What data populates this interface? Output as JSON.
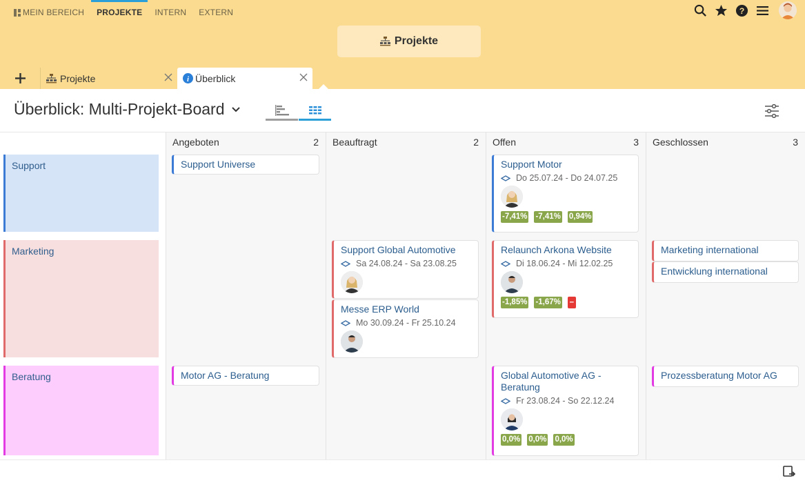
{
  "topnav": {
    "items": [
      {
        "label": "MEIN BEREICH"
      },
      {
        "label": "PROJEKTE"
      },
      {
        "label": "INTERN"
      },
      {
        "label": "EXTERN"
      }
    ],
    "active_index": 1
  },
  "header": {
    "title": "Projekte"
  },
  "tabs": [
    {
      "label": "Projekte",
      "icon": "hierarchy-icon"
    },
    {
      "label": "Überblick",
      "icon": "info-icon"
    }
  ],
  "board": {
    "title": "Überblick: Multi-Projekt-Board",
    "columns": [
      {
        "name": "Angeboten",
        "count": "2"
      },
      {
        "name": "Beauftragt",
        "count": "2"
      },
      {
        "name": "Offen",
        "count": "3"
      },
      {
        "name": "Geschlossen",
        "count": "3"
      }
    ],
    "rows": [
      {
        "name": "Support",
        "color": "#3b7bd6",
        "bg": "#d6e4f7"
      },
      {
        "name": "Marketing",
        "color": "#e06a6a",
        "bg": "#f7dfdf"
      },
      {
        "name": "Beratung",
        "color": "#e33be3",
        "bg": "#fdcdfd"
      }
    ],
    "cards": {
      "support_universe": {
        "title": "Support Universe"
      },
      "support_motor": {
        "title": "Support Motor",
        "dates": "Do 25.07.24 - Do 24.07.25",
        "kpis": [
          "-7,41%",
          "-7,41%",
          "0,94%"
        ]
      },
      "support_global": {
        "title": "Support Global Automotive",
        "dates": "Sa 24.08.24 - Sa 23.08.25"
      },
      "messe_erp": {
        "title": "Messe ERP World",
        "dates": "Mo 30.09.24 - Fr 25.10.24"
      },
      "relaunch": {
        "title": "Relaunch Arkona Website",
        "dates": "Di 18.06.24 - Mi 12.02.25",
        "kpis": [
          "-1,85%",
          "-1,67%"
        ],
        "kpi_flag": "–"
      },
      "marketing_int": {
        "title": "Marketing international"
      },
      "entwicklung_int": {
        "title": "Entwicklung international"
      },
      "motor_ag": {
        "title": "Motor AG - Beratung"
      },
      "global_ag": {
        "title": "Global Automotive AG - Beratung",
        "dates": "Fr 23.08.24 - So 22.12.24",
        "kpis": [
          "0,0%",
          "0,0%",
          "0,0%"
        ]
      },
      "prozess": {
        "title": "Prozessberatung Motor AG"
      }
    }
  },
  "colors": {
    "header_bg": "#fadb8f",
    "accent": "#2a9fd8",
    "kpi_green": "#8aa64a",
    "kpi_red": "#e53935"
  }
}
